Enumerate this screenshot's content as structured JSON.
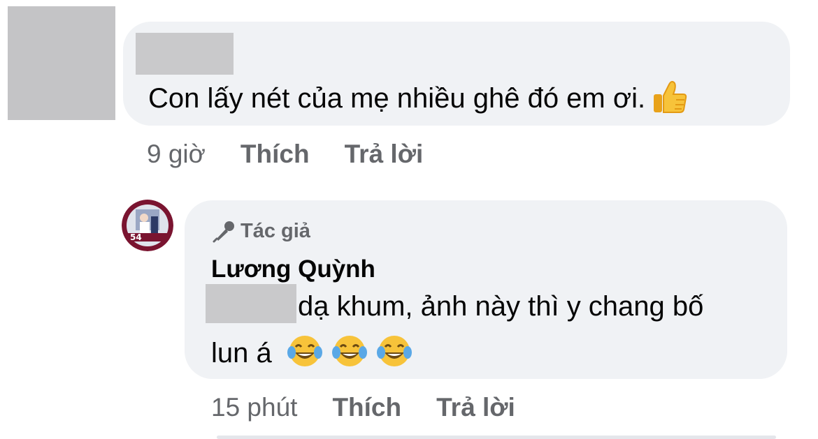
{
  "comment1": {
    "text": "Con lấy nét của mẹ nhiều ghê đó em ơi.",
    "emoji_icon": "thumbs-up-icon",
    "time": "9 giờ",
    "like_label": "Thích",
    "reply_label": "Trả lời"
  },
  "reply": {
    "author_badge": "Tác giả",
    "author_badge_icon": "microphone-icon",
    "author_name": "Lương Quỳnh",
    "text_line1": "dạ khum, ảnh này thì y chang bố",
    "text_line2": "lun á",
    "emoji_icons": [
      "tears-of-joy-icon",
      "tears-of-joy-icon",
      "tears-of-joy-icon"
    ],
    "avatar_badge": "54",
    "time": "15 phút",
    "like_label": "Thích",
    "reply_label": "Trả lời"
  },
  "colors": {
    "bubble": "#f0f2f5",
    "meta_text": "#65676b",
    "blur": "#c9c9cb",
    "avatar_ring": "#7a1430"
  }
}
